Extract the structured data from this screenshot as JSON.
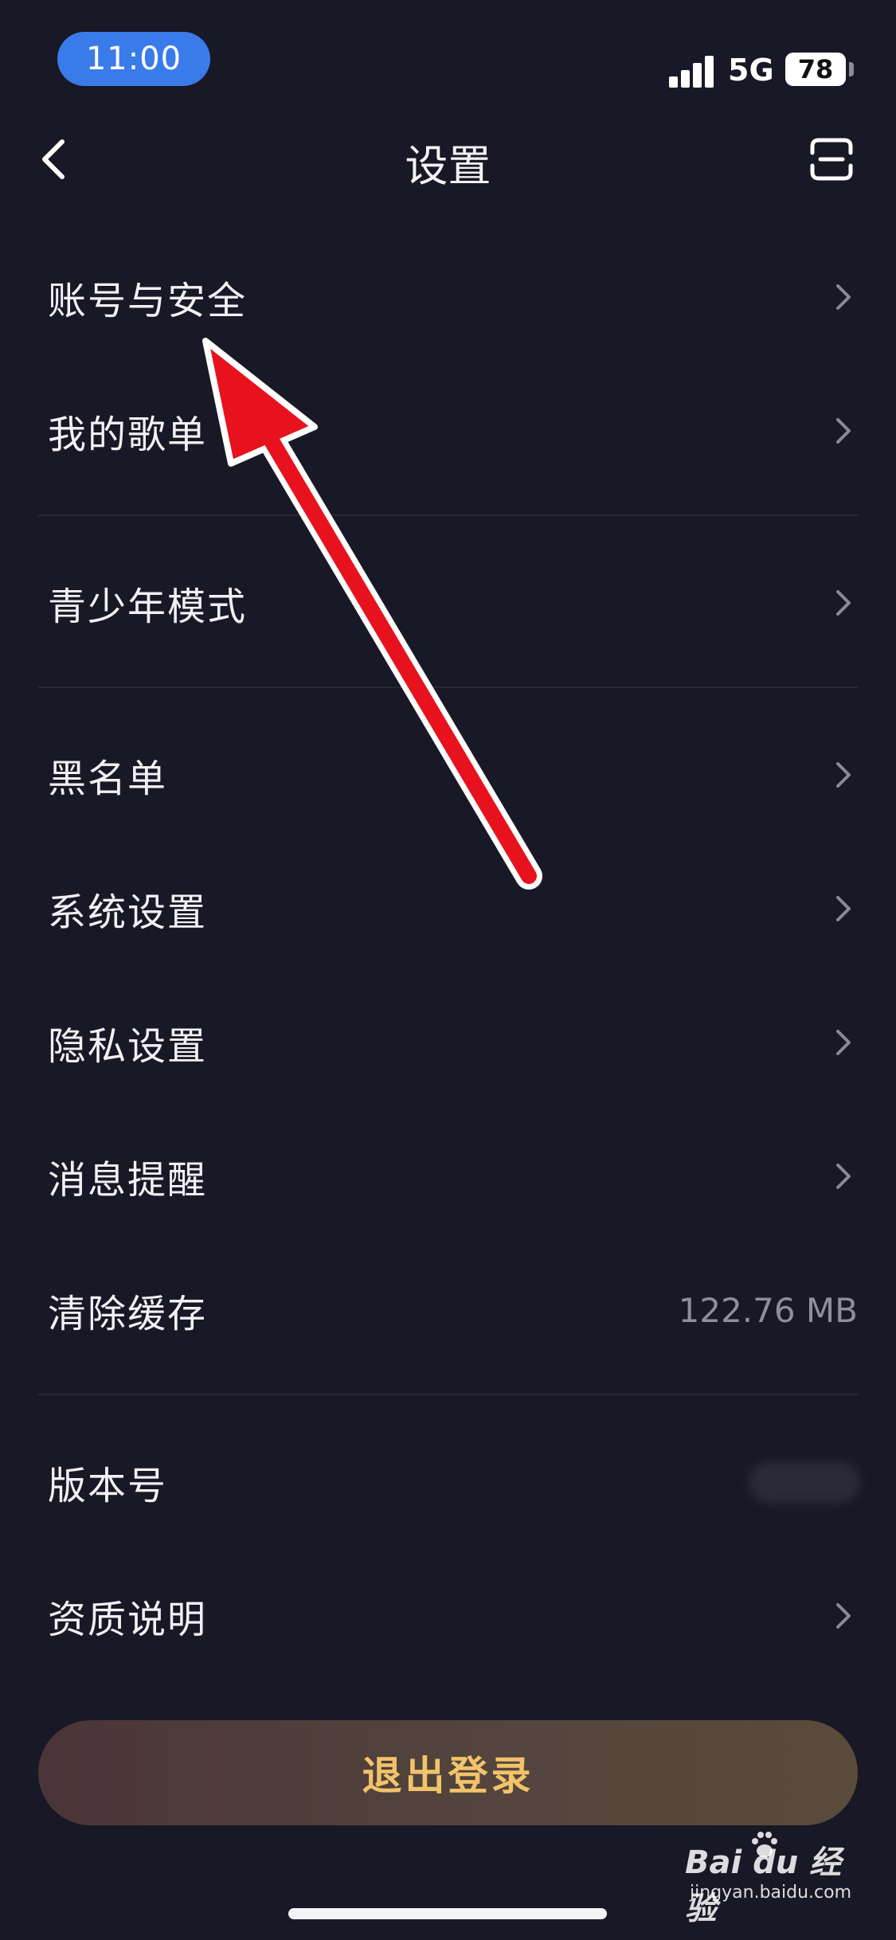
{
  "status_bar": {
    "time": "11:00",
    "network": "5G",
    "battery": "78"
  },
  "nav": {
    "title": "设置"
  },
  "menu": {
    "account_security": "账号与安全",
    "my_playlists": "我的歌单",
    "teen_mode": "青少年模式",
    "blacklist": "黑名单",
    "system_settings": "系统设置",
    "privacy_settings": "隐私设置",
    "message_reminder": "消息提醒",
    "clear_cache": "清除缓存",
    "clear_cache_value": "122.76 MB",
    "version": "版本号",
    "qualification": "资质说明"
  },
  "logout_label": "退出登录",
  "watermark": {
    "main": "Bai du 经验",
    "sub": "jingyan.baidu.com"
  },
  "colors": {
    "background": "#181826",
    "accent_time": "#3a7bea",
    "logout_text": "#f2c36a",
    "arrow": "#e8121e"
  }
}
